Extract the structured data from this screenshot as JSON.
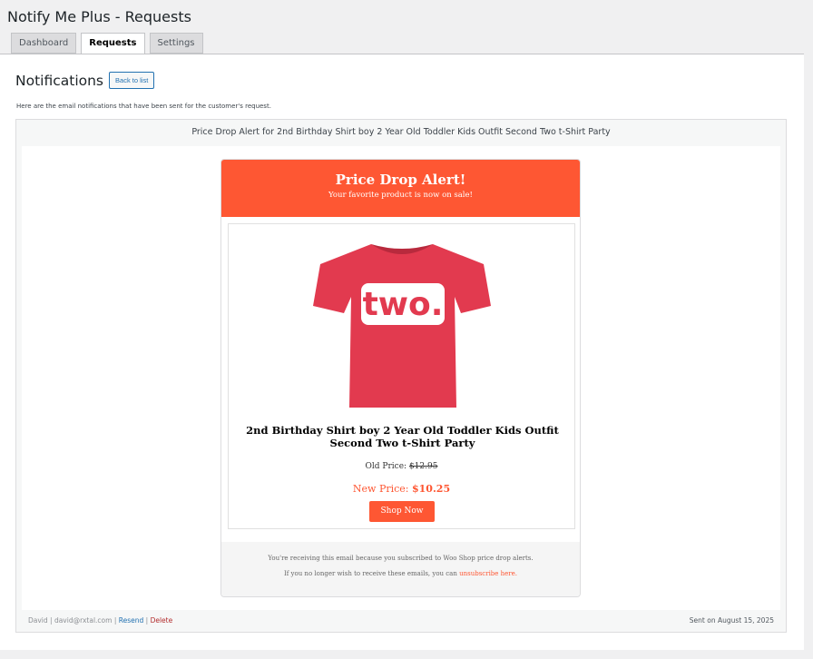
{
  "app": {
    "title": "Notify Me Plus - Requests"
  },
  "tabs": [
    {
      "label": "Dashboard"
    },
    {
      "label": "Requests"
    },
    {
      "label": "Settings"
    }
  ],
  "page": {
    "heading": "Notifications",
    "back_button": "Back to list",
    "intro": "Here are the email notifications that have been sent for the customer's request."
  },
  "notification": {
    "title": "Price Drop Alert for 2nd Birthday Shirt boy 2 Year Old Toddler Kids Outfit Second Two t-Shirt Party",
    "email": {
      "header_title": "Price Drop Alert!",
      "header_subtitle": "Your favorite product is now on sale!",
      "product_name": "2nd Birthday Shirt boy 2 Year Old Toddler Kids Outfit Second Two t-Shirt Party",
      "product_image_text": "two.",
      "old_price_label": "Old Price:",
      "old_price": "$12.95",
      "new_price_label": "New Price:",
      "new_price": "$10.25",
      "shop_button": "Shop Now",
      "footer_line1": "You're receiving this email because you subscribed to Woo Shop price drop alerts.",
      "footer_line2_prefix": "If you no longer wish to receive these emails, you can",
      "unsubscribe_link": "unsubscribe here."
    },
    "customer_name": "David",
    "customer_email": "david@rxtal.com",
    "resend_label": "Resend",
    "delete_label": "Delete",
    "sent_on": "Sent on August 15, 2025"
  },
  "colors": {
    "accent": "#fe5733",
    "shirt": "#e23a4f",
    "link": "#2271b1",
    "delete": "#b32d2e"
  }
}
